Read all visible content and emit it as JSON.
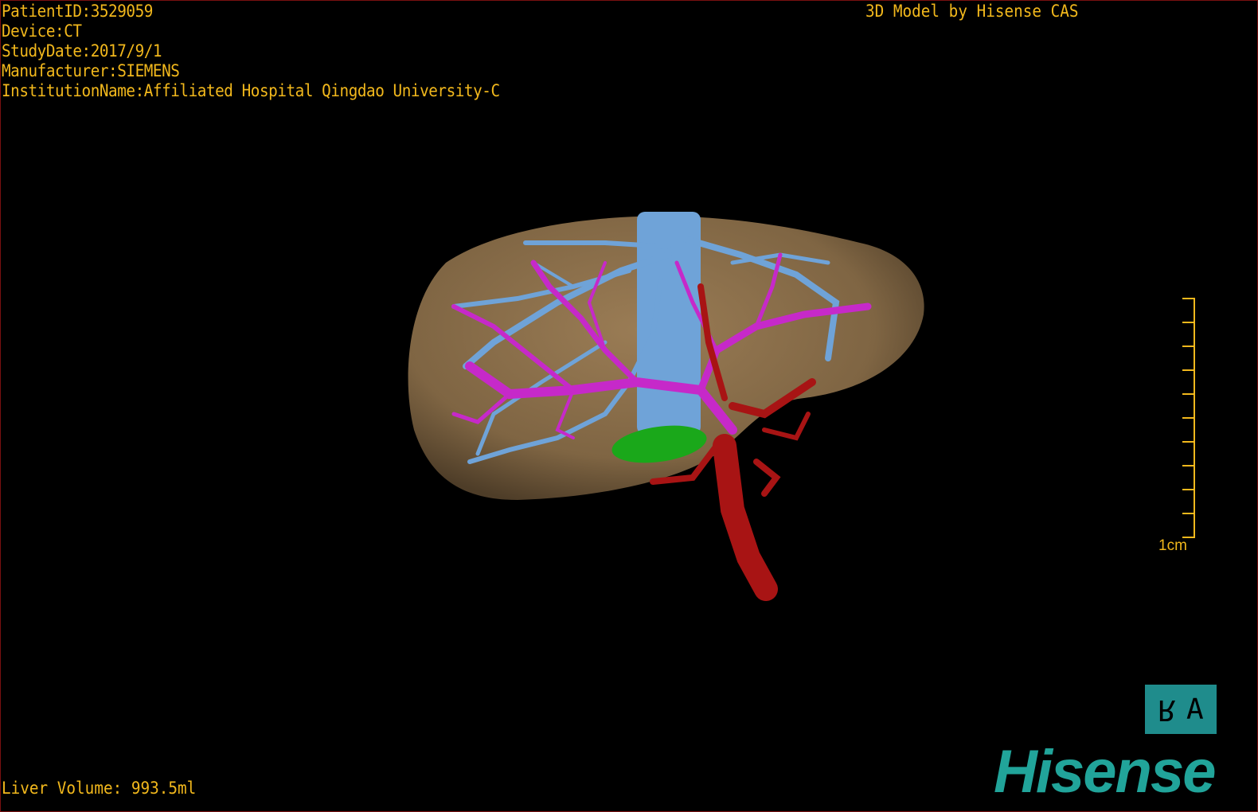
{
  "overlay": {
    "patient_id": "PatientID:3529059",
    "device": "Device:CT",
    "study_date": "StudyDate:2017/9/1",
    "manufacturer": "Manufacturer:SIEMENS",
    "institution": "InstitutionName:Affiliated Hospital Qingdao University-C",
    "credit": "3D Model by Hisense CAS",
    "liver_volume": "Liver Volume: 993.5ml"
  },
  "scale_bar": {
    "label": "1cm",
    "divisions": 10
  },
  "orientation_cube": {
    "labels": [
      "R",
      "A"
    ]
  },
  "logo": {
    "text": "Hisense"
  },
  "colors": {
    "overlay_text": "#f2b81c",
    "liver": "#8a6e4a",
    "hepatic_vein": "#6fa3d8",
    "portal_vein": "#c629c9",
    "artery": "#a81414",
    "gallbladder": "#1aa81a",
    "brand": "#21a49a"
  }
}
